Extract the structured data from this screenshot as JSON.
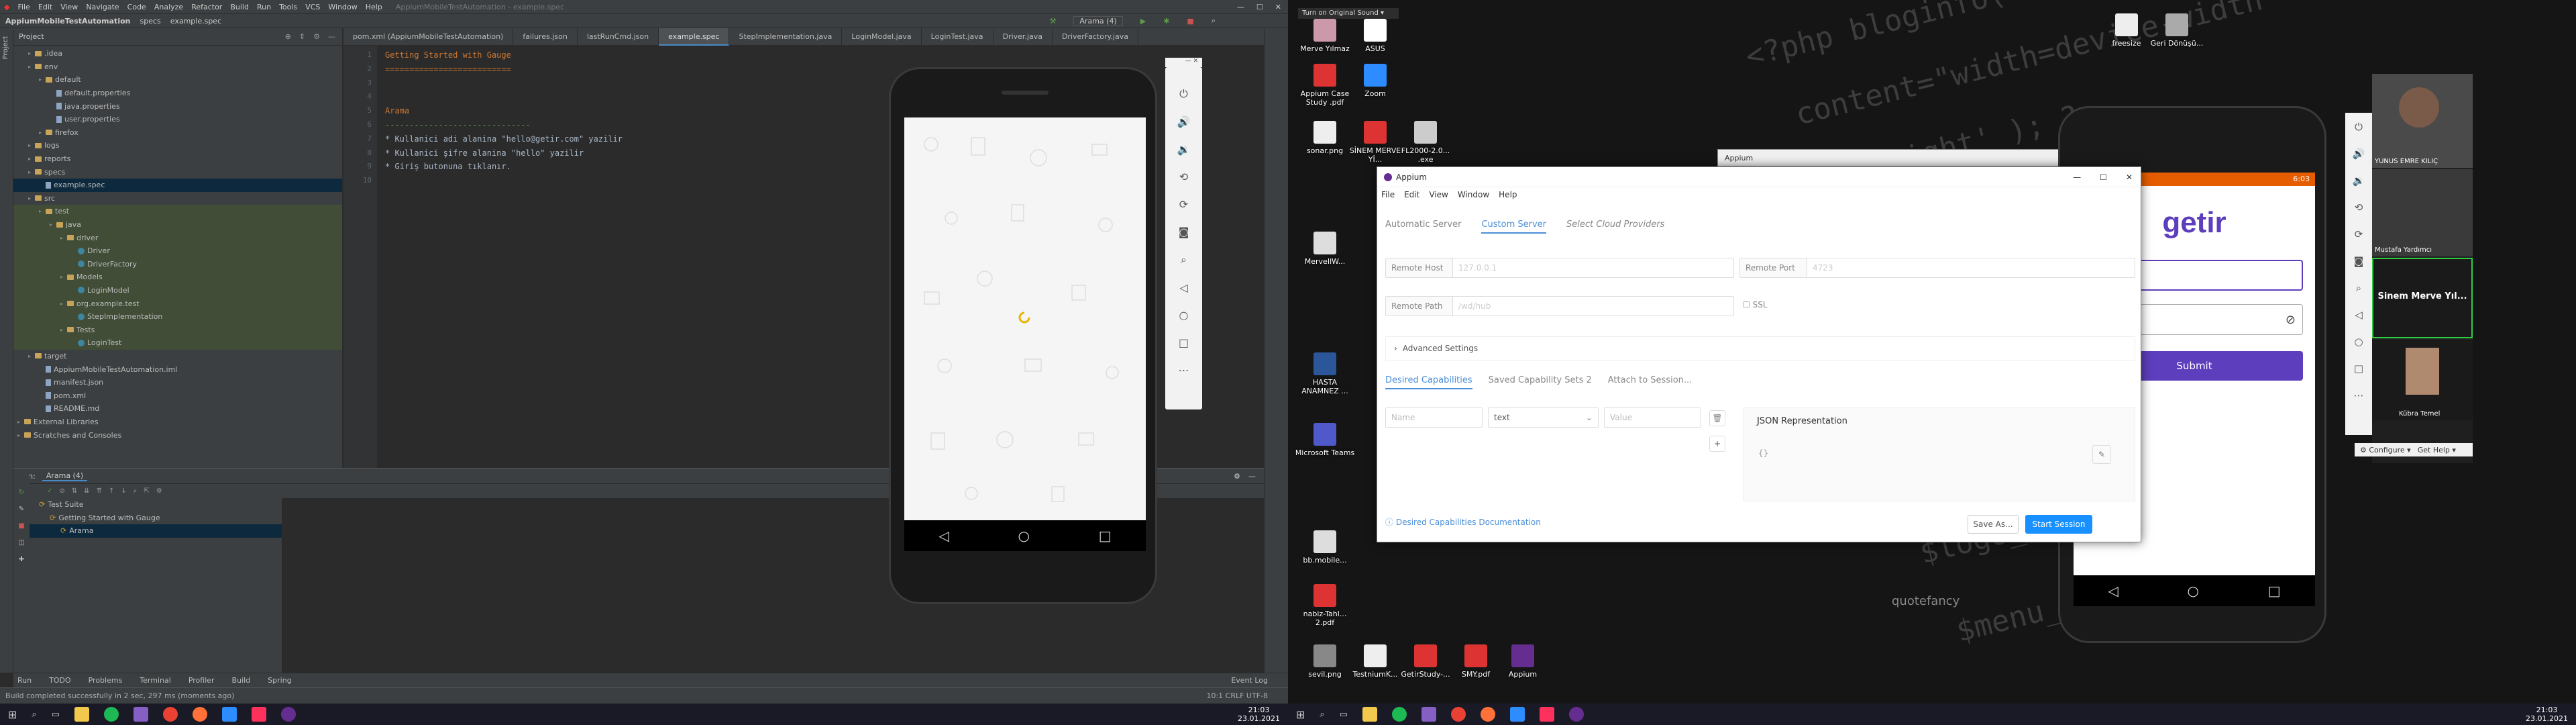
{
  "ide": {
    "menu": [
      "File",
      "Edit",
      "View",
      "Navigate",
      "Code",
      "Analyze",
      "Refactor",
      "Build",
      "Run",
      "Tools",
      "VCS",
      "Window",
      "Help"
    ],
    "window_title": "AppiumMobileTestAutomation - example.spec",
    "breadcrumbs": [
      "AppiumMobileTestAutomation",
      "specs",
      "example.spec"
    ],
    "run_config": "Arama (4)",
    "project_label": "Project",
    "tabs": [
      "pom.xml (AppiumMobileTestAutomation)",
      "failures.json",
      "lastRunCmd.json",
      "example.spec",
      "StepImplementation.java",
      "LoginModel.java",
      "LoginTest.java",
      "Driver.java",
      "DriverFactory.java"
    ],
    "tree": [
      {
        "label": ".idea",
        "indent": 1
      },
      {
        "label": "env",
        "indent": 1
      },
      {
        "label": "default",
        "indent": 2
      },
      {
        "label": "default.properties",
        "indent": 3
      },
      {
        "label": "java.properties",
        "indent": 3
      },
      {
        "label": "user.properties",
        "indent": 3
      },
      {
        "label": "firefox",
        "indent": 2
      },
      {
        "label": "logs",
        "indent": 1
      },
      {
        "label": "reports",
        "indent": 1
      },
      {
        "label": "specs",
        "indent": 1
      },
      {
        "label": "example.spec",
        "indent": 2
      },
      {
        "label": "src",
        "indent": 1
      },
      {
        "label": "test",
        "indent": 2
      },
      {
        "label": "java",
        "indent": 3
      },
      {
        "label": "driver",
        "indent": 4
      },
      {
        "label": "Driver",
        "indent": 5
      },
      {
        "label": "DriverFactory",
        "indent": 5
      },
      {
        "label": "Models",
        "indent": 4
      },
      {
        "label": "LoginModel",
        "indent": 5
      },
      {
        "label": "org.example.test",
        "indent": 4
      },
      {
        "label": "StepImplementation",
        "indent": 5
      },
      {
        "label": "Tests",
        "indent": 4
      },
      {
        "label": "LoginTest",
        "indent": 5
      },
      {
        "label": "target",
        "indent": 1
      },
      {
        "label": "AppiumMobileTestAutomation.iml",
        "indent": 2
      },
      {
        "label": "manifest.json",
        "indent": 2
      },
      {
        "label": "pom.xml",
        "indent": 2
      },
      {
        "label": "README.md",
        "indent": 2
      },
      {
        "label": "External Libraries",
        "indent": 0
      },
      {
        "label": "Scratches and Consoles",
        "indent": 0
      }
    ],
    "gutter": [
      "1",
      "2",
      "3",
      "4",
      "5",
      "6",
      "7",
      "8",
      "9",
      "10"
    ],
    "code": [
      "Getting Started with Gauge",
      "==========================",
      "",
      "",
      "Arama",
      "------------------------------",
      "* Kullanici adi alanina \"hello@getir.com\" yazilir",
      "* Kullanici şifre alanina \"hello\" yazilir",
      "* Giriş butonuna tıklanır.",
      ""
    ],
    "run_tab": "Run:",
    "run_config_tab": "Arama (4)",
    "run_tree": [
      "Test Suite",
      "Getting Started with Gauge",
      "Arama"
    ],
    "bottom_tabs": [
      "Run",
      "TODO",
      "Problems",
      "Terminal",
      "Profiler",
      "Build",
      "Spring"
    ],
    "event_log": "Event Log",
    "status": "Build completed successfully in 2 sec, 297 ms (moments ago)",
    "status_right": "10:1  CRLF  UTF-8"
  },
  "desktop": {
    "icons": [
      {
        "label": "Merve Yılmaz"
      },
      {
        "label": "ASUS"
      },
      {
        "label": "Appium Case Study .pdf"
      },
      {
        "label": "Zoom"
      },
      {
        "label": "sonar.png"
      },
      {
        "label": "SİNEM MERVE Yİ..."
      },
      {
        "label": "FL2000-2.0... .exe"
      },
      {
        "label": "MerveIlW..."
      },
      {
        "label": "HASTA ANAMNEZ ..."
      },
      {
        "label": "Microsoft Teams"
      },
      {
        "label": "bb.mobile..."
      },
      {
        "label": "nabiz-Tahl... 2.pdf"
      },
      {
        "label": "sevil.png"
      },
      {
        "label": "TestniumK..."
      },
      {
        "label": "GetirStudy-..."
      },
      {
        "label": "SMY.pdf"
      },
      {
        "label": "Appium"
      },
      {
        "label": "freesize"
      },
      {
        "label": "Geri Dönüşü..."
      }
    ],
    "sound_bar": "Turn on Original Sound",
    "watermark": "quotefancy"
  },
  "appium": {
    "title": "Appium",
    "menu": [
      "File",
      "Edit",
      "View",
      "Window",
      "Help"
    ],
    "server_tabs": [
      "Automatic Server",
      "Custom Server",
      "Select Cloud Providers"
    ],
    "remote_host_label": "Remote Host",
    "remote_host_value": "127.0.0.1",
    "remote_port_label": "Remote Port",
    "remote_port_value": "4723",
    "remote_path_label": "Remote Path",
    "remote_path_value": "/wd/hub",
    "ssl_label": "SSL",
    "advanced": "Advanced Settings",
    "cap_tabs": [
      "Desired Capabilities",
      "Saved Capability Sets 2",
      "Attach to Session..."
    ],
    "name_placeholder": "Name",
    "type_value": "text",
    "value_placeholder": "Value",
    "json_title": "JSON Representation",
    "json_body": "{}",
    "docs_link": "Desired Capabilities Documentation",
    "save_as": "Save As...",
    "start_session": "Start Session"
  },
  "phone2": {
    "status_time": "6:03",
    "logo": "getir",
    "submit": "Submit"
  },
  "appium_back_title": "Appium",
  "zoom": {
    "participants": [
      "YUNUS EMRE KILIÇ",
      "Mustafa Yardımcı",
      "Sinem Merve Yıl...",
      "Kübra Temel"
    ],
    "configure": "Configure",
    "get_help": "Get Help"
  },
  "taskbar": {
    "time": "21:03",
    "date": "23.01.2021"
  },
  "colors": {
    "accent": "#4a8fd8",
    "getir": "#5d3ebc",
    "ide_bg": "#2b2b2b"
  }
}
